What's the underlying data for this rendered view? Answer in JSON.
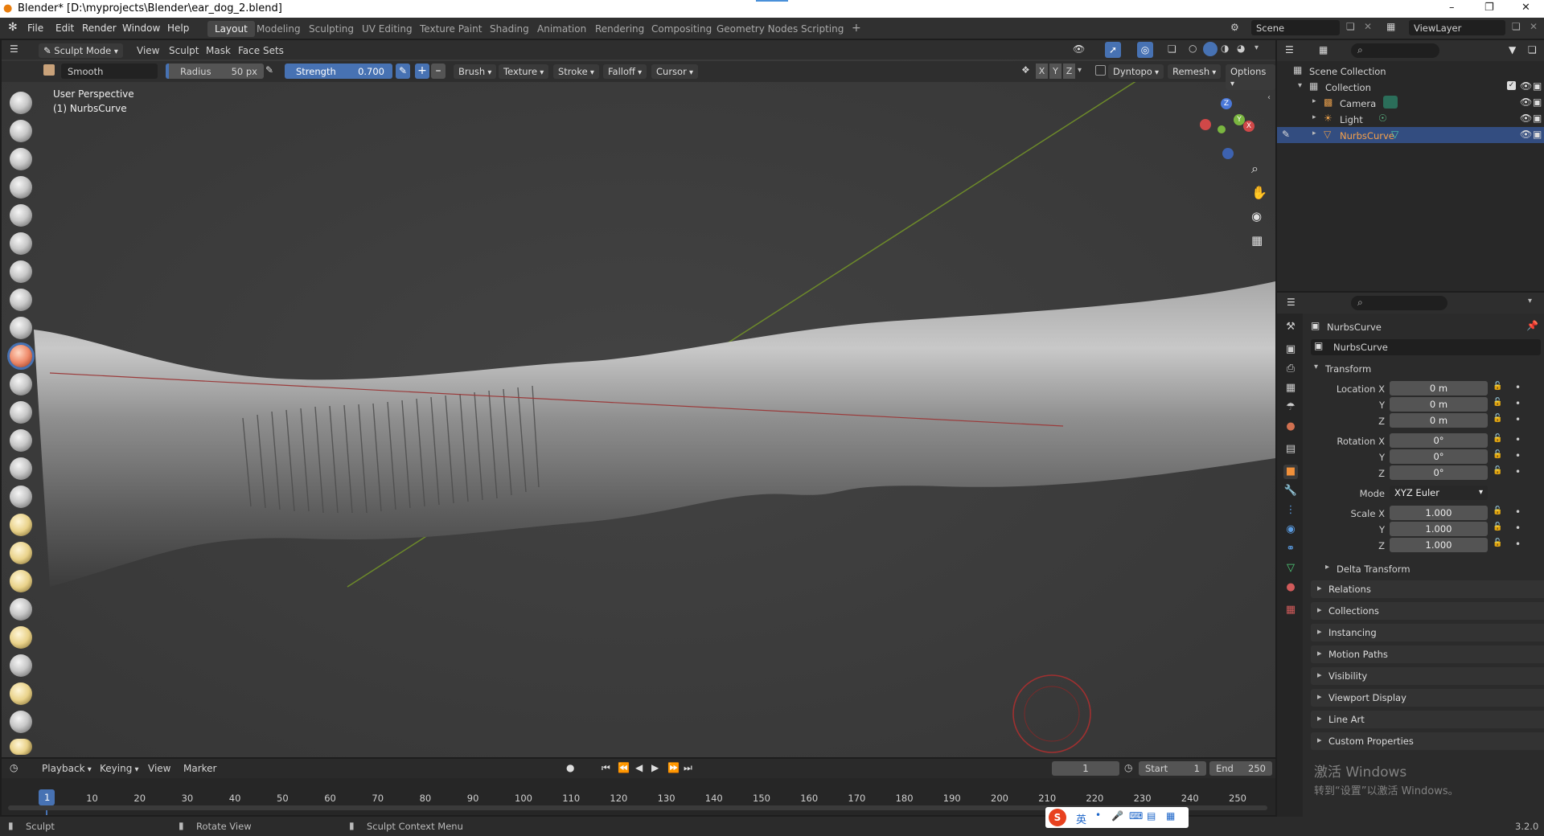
{
  "titlebar": {
    "title": "Blender* [D:\\myprojects\\Blender\\ear_dog_2.blend]",
    "minimize": "–",
    "restore": "❐",
    "close": "✕"
  },
  "menu": [
    "File",
    "Edit",
    "Render",
    "Window",
    "Help"
  ],
  "workspaces": [
    "Layout",
    "Modeling",
    "Sculpting",
    "UV Editing",
    "Texture Paint",
    "Shading",
    "Animation",
    "Rendering",
    "Compositing",
    "Geometry Nodes",
    "Scripting",
    "+"
  ],
  "scene_label": "Scene",
  "viewlayer_label": "ViewLayer",
  "viewport_header": {
    "mode": "Sculpt Mode",
    "menus": [
      "View",
      "Sculpt",
      "Mask",
      "Face Sets"
    ]
  },
  "tool_settings": {
    "brush_name": "Smooth",
    "radius_label": "Radius",
    "radius_value": "50 px",
    "strength_label": "Strength",
    "strength_value": "0.700",
    "plus": "+",
    "minus": "–",
    "menus": [
      "Brush",
      "Texture",
      "Stroke",
      "Falloff",
      "Cursor"
    ],
    "axis_x": "X",
    "axis_y": "Y",
    "axis_z": "Z",
    "dyntopo": "Dyntopo",
    "remesh": "Remesh",
    "options": "Options"
  },
  "viewport_overlay": {
    "line1": "User Perspective",
    "line2": "(1) NurbsCurve"
  },
  "gizmo": {
    "x": "X",
    "y": "Y",
    "z": "Z"
  },
  "timeline": {
    "menus": [
      "Playback",
      "Keying",
      "View",
      "Marker"
    ],
    "current_frame": "1",
    "start_label": "Start",
    "start_value": "1",
    "end_label": "End",
    "end_value": "250",
    "ticks": [
      "1",
      "10",
      "20",
      "30",
      "40",
      "50",
      "60",
      "70",
      "80",
      "90",
      "100",
      "110",
      "120",
      "130",
      "140",
      "150",
      "160",
      "170",
      "180",
      "190",
      "200",
      "210",
      "220",
      "230",
      "240",
      "250"
    ]
  },
  "statusbar": {
    "left": "Sculpt",
    "middle": "Rotate View",
    "right": "Sculpt Context Menu",
    "version": "3.2.0"
  },
  "outliner": {
    "scene_collection": "Scene Collection",
    "collection": "Collection",
    "items": [
      "Camera",
      "Light",
      "NurbsCurve"
    ]
  },
  "properties": {
    "object_name": "NurbsCurve",
    "datablock": "NurbsCurve",
    "transform": "Transform",
    "location_label": "Location X",
    "rotation_label": "Rotation X",
    "scale_label": "Scale X",
    "y_label": "Y",
    "z_label": "Z",
    "location": [
      "0 m",
      "0 m",
      "0 m"
    ],
    "rotation": [
      "0°",
      "0°",
      "0°"
    ],
    "mode_label": "Mode",
    "mode_value": "XYZ Euler",
    "scale": [
      "1.000",
      "1.000",
      "1.000"
    ],
    "delta": "Delta Transform",
    "panels": [
      "Relations",
      "Collections",
      "Instancing",
      "Motion Paths",
      "Visibility",
      "Viewport Display",
      "Line Art",
      "Custom Properties"
    ]
  },
  "watermark": {
    "line1": "激活 Windows",
    "line2": "转到“设置”以激活 Windows。"
  },
  "ime": {
    "lang": "英"
  },
  "colors": {
    "accent": "#4772b3",
    "active_row": "#334d80",
    "x_axis": "#9b3b3b",
    "y_axis": "#6d8a2a"
  }
}
